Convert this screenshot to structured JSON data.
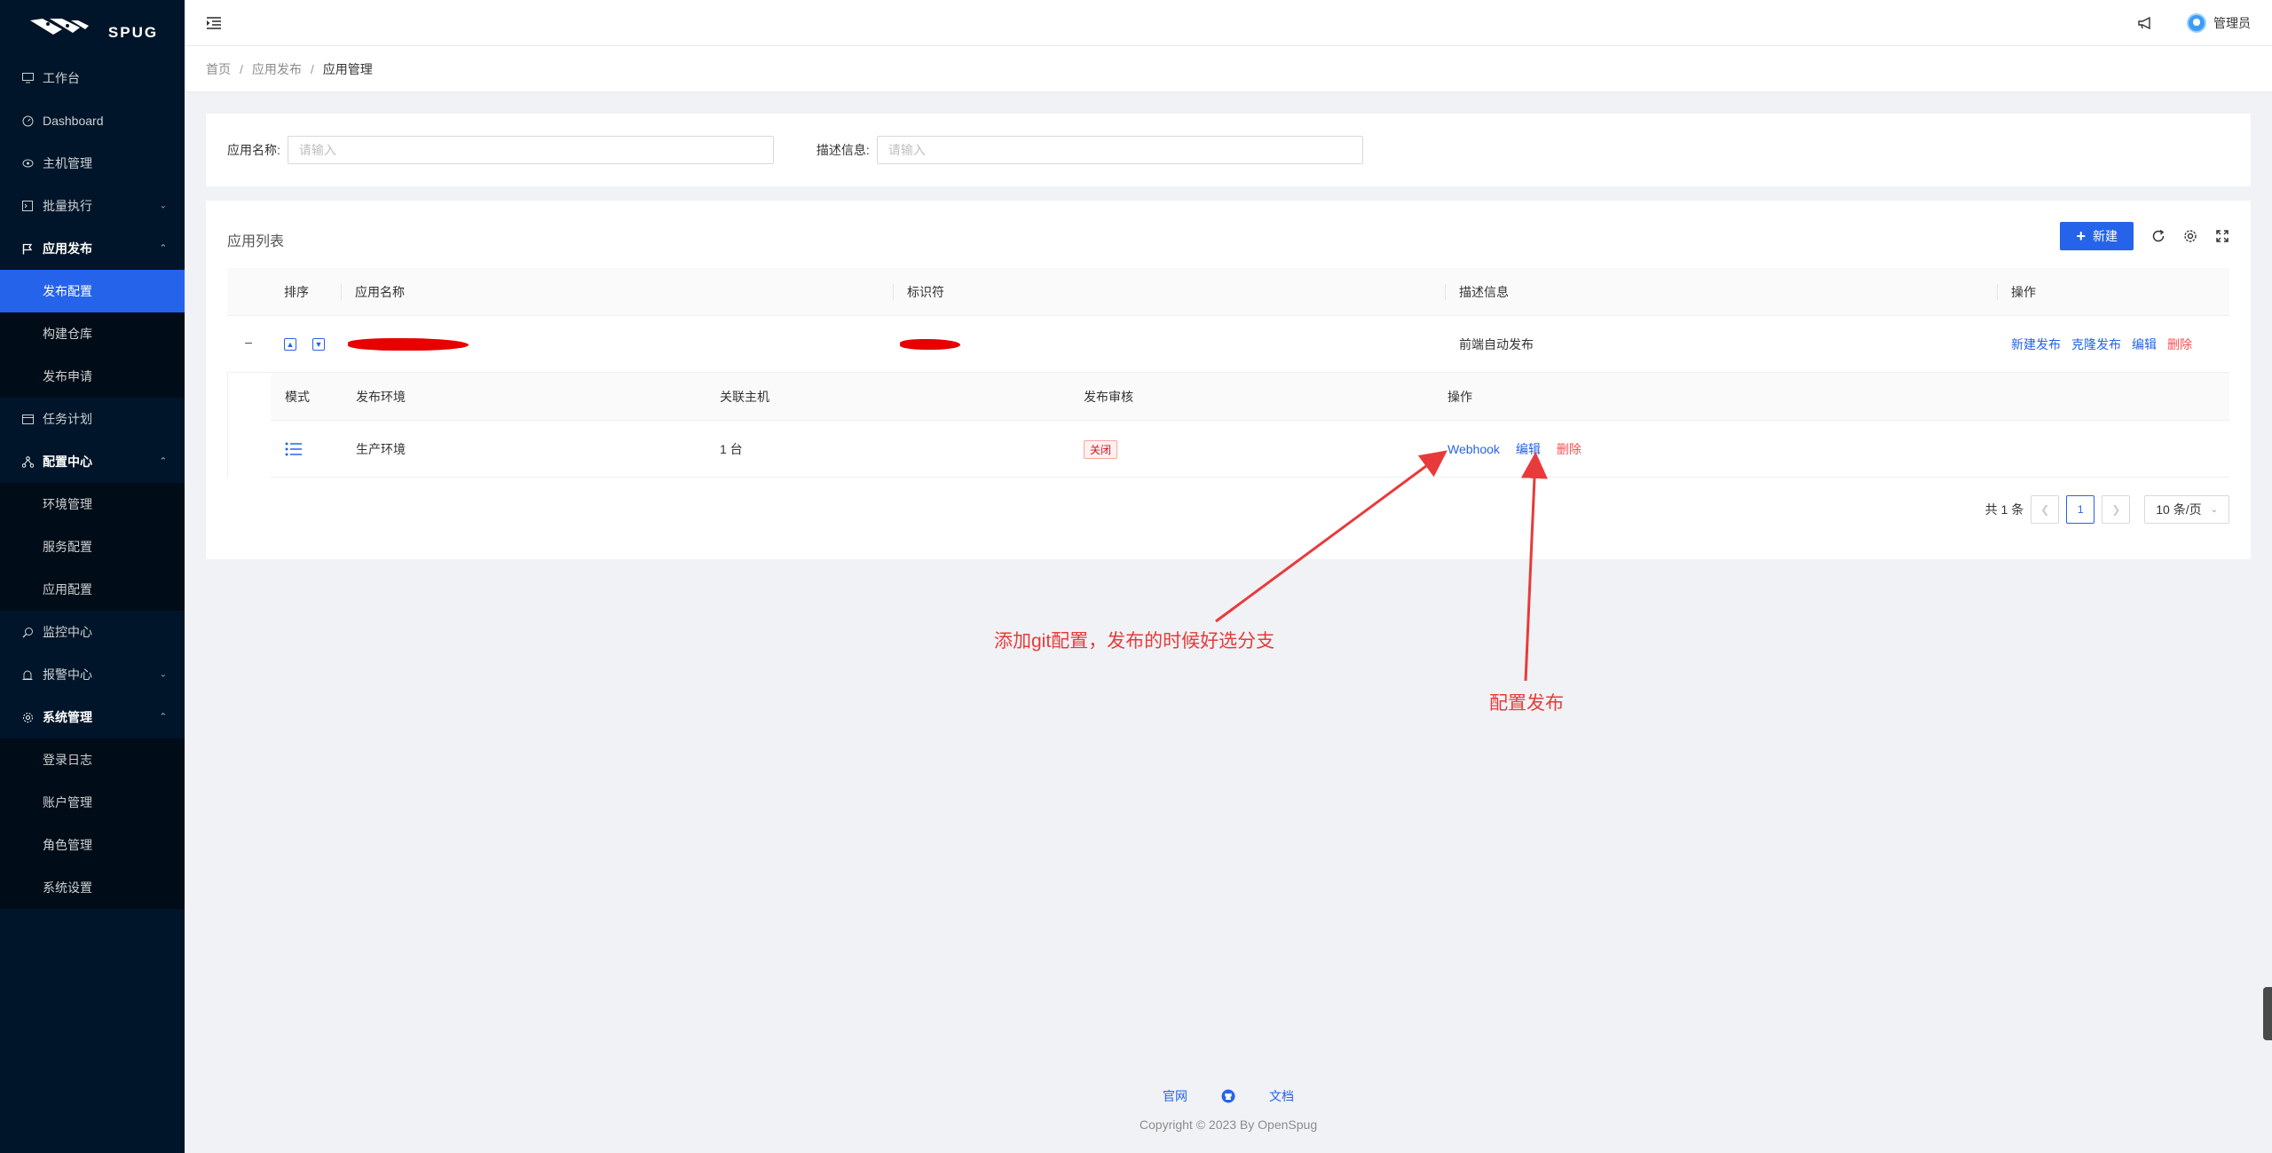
{
  "brand": {
    "logo_text": "SPUG"
  },
  "sidebar": {
    "items": [
      {
        "label": "工作台",
        "icon": "desktop-icon"
      },
      {
        "label": "Dashboard",
        "icon": "dashboard-icon"
      },
      {
        "label": "主机管理",
        "icon": "cloud-server-icon"
      },
      {
        "label": "批量执行",
        "icon": "code-icon"
      },
      {
        "label": "应用发布",
        "icon": "flag-icon"
      },
      {
        "label": "发布配置"
      },
      {
        "label": "构建仓库"
      },
      {
        "label": "发布申请"
      },
      {
        "label": "任务计划",
        "icon": "schedule-icon"
      },
      {
        "label": "配置中心",
        "icon": "deployment-icon"
      },
      {
        "label": "环境管理"
      },
      {
        "label": "服务配置"
      },
      {
        "label": "应用配置"
      },
      {
        "label": "监控中心",
        "icon": "monitor-icon"
      },
      {
        "label": "报警中心",
        "icon": "alarm-icon"
      },
      {
        "label": "系统管理",
        "icon": "setting-icon"
      },
      {
        "label": "登录日志"
      },
      {
        "label": "账户管理"
      },
      {
        "label": "角色管理"
      },
      {
        "label": "系统设置"
      }
    ]
  },
  "header": {
    "user_name": "管理员"
  },
  "breadcrumb": [
    "首页",
    "应用发布",
    "应用管理"
  ],
  "search": {
    "name_label": "应用名称:",
    "name_placeholder": "请输入",
    "desc_label": "描述信息:",
    "desc_placeholder": "请输入"
  },
  "table": {
    "title": "应用列表",
    "new_button": "新建",
    "columns": [
      "排序",
      "应用名称",
      "标识符",
      "描述信息",
      "操作"
    ],
    "row": {
      "description": "前端自动发布",
      "actions": [
        "新建发布",
        "克隆发布",
        "编辑",
        "删除"
      ]
    },
    "nested_columns": [
      "模式",
      "发布环境",
      "关联主机",
      "发布审核",
      "操作"
    ],
    "nested_row": {
      "environment": "生产环境",
      "hosts": "1 台",
      "review": "关闭",
      "actions": [
        "Webhook",
        "编辑",
        "删除"
      ]
    }
  },
  "pagination": {
    "total": "共 1 条",
    "current": "1",
    "page_size": "10 条/页"
  },
  "annotations": {
    "git_note": "添加git配置，发布的时候好选分支",
    "publish_note": "配置发布",
    "color": "#e83a3a"
  },
  "footer": {
    "links": [
      "官网",
      "文档"
    ],
    "copyright": "Copyright © 2023 By OpenSpug"
  },
  "colors": {
    "primary": "#2563eb",
    "sidebar_bg": "#001529",
    "danger": "#ff4d4f"
  }
}
